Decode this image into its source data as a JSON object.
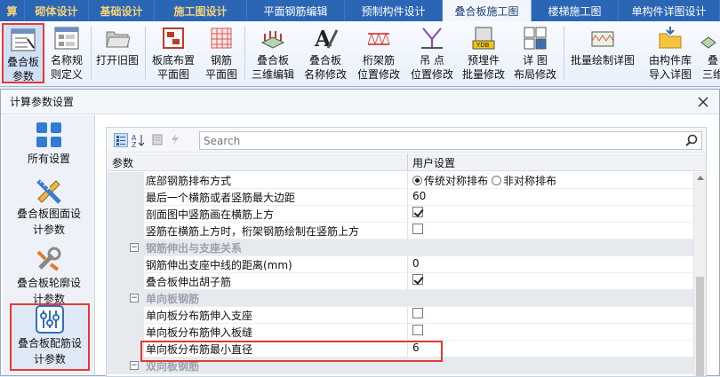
{
  "tabs": [
    {
      "label": "算",
      "style": "bold"
    },
    {
      "label": "砌体设计",
      "style": "bold"
    },
    {
      "label": "基础设计",
      "style": "bold"
    },
    {
      "label": "施工图设计",
      "style": "bold"
    },
    {
      "label": "平面钢筋编辑",
      "style": "plain"
    },
    {
      "label": "预制构件设计",
      "style": "plain"
    },
    {
      "label": "叠合板施工图",
      "style": "active"
    },
    {
      "label": "楼梯施工图",
      "style": "plain"
    },
    {
      "label": "单构件详图设计",
      "style": "plain"
    }
  ],
  "ribbon": {
    "buttons": [
      {
        "label": "叠合板\n参数",
        "icon": "params-icon"
      },
      {
        "label": "名称规\n则定义",
        "icon": "naming-rules-icon"
      },
      {
        "label": "打开旧图",
        "icon": "folder-open-icon"
      },
      {
        "label": "板底布置\n平面图",
        "icon": "floor-plan-icon"
      },
      {
        "label": "钢筋\n平面图",
        "icon": "rebar-plan-icon"
      },
      {
        "label": "叠合板\n三维编辑",
        "icon": "3d-edit-icon"
      },
      {
        "label": "叠合板\n名称修改",
        "icon": "rename-icon"
      },
      {
        "label": "桁架筋\n位置修改",
        "icon": "truss-icon"
      },
      {
        "label": "吊  点\n位置修改",
        "icon": "lifting-point-icon"
      },
      {
        "label": "预埋件\n批量修改",
        "icon": "embedded-part-icon"
      },
      {
        "label": "详  图\n布局修改",
        "icon": "layout-icon"
      },
      {
        "label": "批量绘制详图",
        "icon": "batch-draw-icon"
      },
      {
        "label": "由构件库\n导入详图",
        "icon": "import-icon"
      },
      {
        "label": "叠\n三维",
        "icon": "3d-icon"
      }
    ]
  },
  "dialog": {
    "title": "计算参数设置",
    "nav": [
      {
        "label": "所有设置",
        "icon": "grid-icon"
      },
      {
        "label": "叠合板图面设\n计参数",
        "icon": "pencil-ruler-icon"
      },
      {
        "label": "叠合板轮廓设\n计参数",
        "icon": "wrench-icon"
      },
      {
        "label": "叠合板配筋设\n计参数",
        "icon": "sliders-icon"
      }
    ],
    "search_placeholder": "Search",
    "col_param": "参数",
    "col_value": "用户设置",
    "rows": [
      {
        "type": "prop",
        "name": "底部钢筋排布方式",
        "value_kind": "radio",
        "options": [
          "传统对称排布",
          "非对称排布"
        ],
        "selected": 0
      },
      {
        "type": "prop",
        "name": "最后一个横筋或者竖筋最大边距",
        "value_kind": "text",
        "value": "60"
      },
      {
        "type": "prop",
        "name": "剖面图中竖筋画在横筋上方",
        "value_kind": "check",
        "checked": true
      },
      {
        "type": "prop",
        "name": "竖筋在横筋上方时，桁架钢筋绘制在竖筋上方",
        "value_kind": "check",
        "checked": false
      },
      {
        "type": "cat",
        "name": "钢筋伸出与支座关系"
      },
      {
        "type": "prop",
        "name": "钢筋伸出支座中线的距离(mm)",
        "value_kind": "text",
        "value": "0"
      },
      {
        "type": "prop",
        "name": "叠合板伸出胡子筋",
        "value_kind": "check",
        "checked": true
      },
      {
        "type": "cat",
        "name": "单向板钢筋"
      },
      {
        "type": "prop",
        "name": "单向板分布筋伸入支座",
        "value_kind": "check",
        "checked": false
      },
      {
        "type": "prop",
        "name": "单向板分布筋伸入板缝",
        "value_kind": "check",
        "checked": false
      },
      {
        "type": "prop",
        "name": "单向板分布筋最小直径",
        "value_kind": "text",
        "value": "6"
      },
      {
        "type": "cat",
        "name": "双向板钢筋"
      }
    ]
  },
  "colors": {
    "tab_bar": "#2b66b5",
    "tab_gold": "#f4d37a",
    "highlight": "#e53935"
  }
}
